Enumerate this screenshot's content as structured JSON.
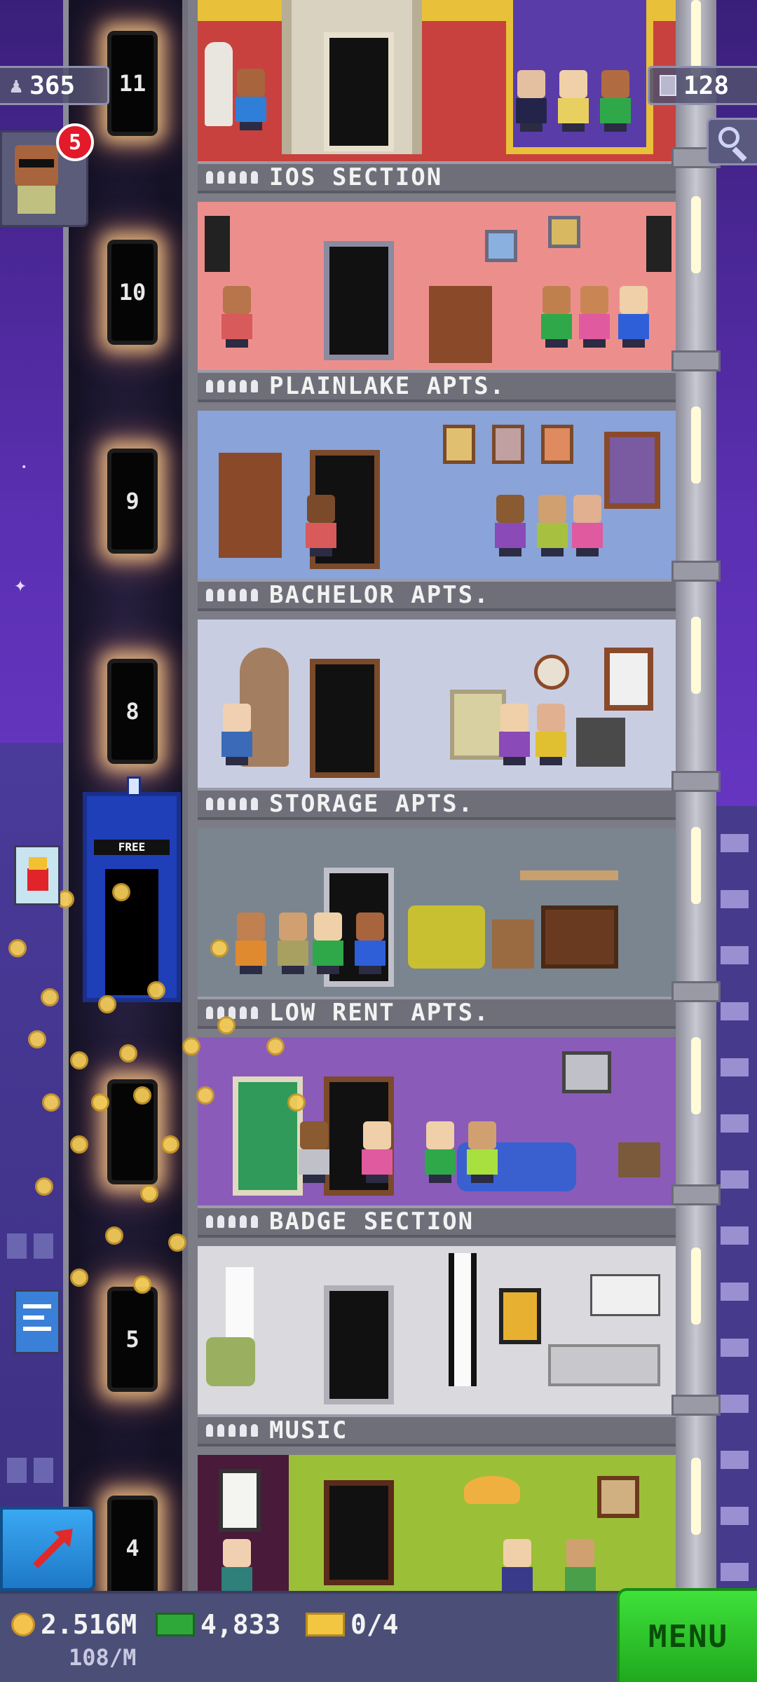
{
  "hud": {
    "population": "365",
    "floor_count": "128",
    "notification_count": "5"
  },
  "elevator": {
    "floor_numbers": [
      "11",
      "10",
      "9",
      "8",
      "5",
      "4"
    ],
    "vehicle_sign": "FREE"
  },
  "floors": [
    {
      "name": "IOS SECTION",
      "theme": "#c8413e"
    },
    {
      "name": "PLAINLAKE APTS.",
      "theme": "#ec8f8c"
    },
    {
      "name": "BACHELOR APTS.",
      "theme": "#8aa3d8"
    },
    {
      "name": "STORAGE APTS.",
      "theme": "#c9cde2"
    },
    {
      "name": "LOW RENT APTS.",
      "theme": "#7a8590"
    },
    {
      "name": "BADGE SECTION",
      "theme": "#8a5bb8"
    },
    {
      "name": "MUSIC",
      "theme": "#d9d9de"
    },
    {
      "name": "",
      "theme": "#9cbf38"
    }
  ],
  "bottom": {
    "coins": "2.516M",
    "coin_rate": "108/M",
    "bux": "4,833",
    "tickets": "0/4",
    "menu_label": "MENU"
  },
  "icons": {
    "population": "person-icon",
    "floors": "building-icon",
    "search": "magnifier-icon",
    "coins": "coin-icon",
    "bux": "bux-icon",
    "tickets": "ticket-icon",
    "rocket": "rocket-arrow-icon"
  },
  "colors": {
    "menu": "#2fc42c",
    "badge": "#e21a2a",
    "label_bar": "#6f6f7a"
  }
}
